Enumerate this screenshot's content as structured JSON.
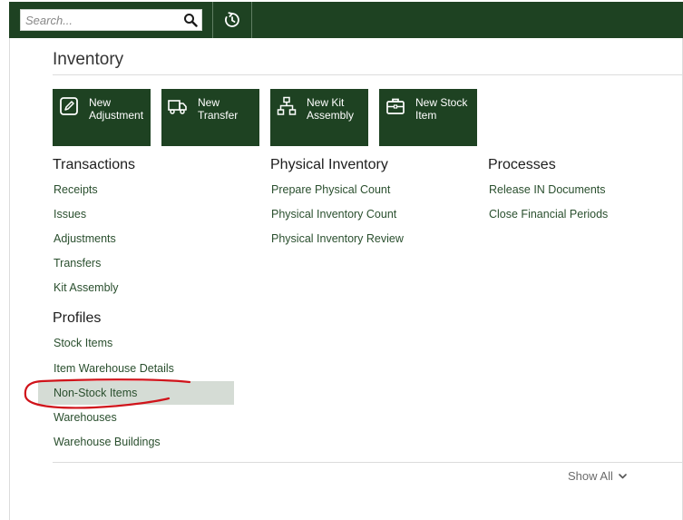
{
  "header": {
    "search_placeholder": "Search...",
    "search_icon": "search-icon",
    "history_icon": "history-icon"
  },
  "page": {
    "title": "Inventory"
  },
  "tiles": [
    {
      "line1": "New",
      "line2": "Adjustment",
      "icon": "edit-icon"
    },
    {
      "line1": "New",
      "line2": "Transfer",
      "icon": "truck-icon"
    },
    {
      "line1": "New Kit",
      "line2": "Assembly",
      "icon": "hierarchy-icon"
    },
    {
      "line1": "New Stock",
      "line2": "Item",
      "icon": "briefcase-icon"
    }
  ],
  "sections": {
    "transactions": {
      "title": "Transactions",
      "items": [
        "Receipts",
        "Issues",
        "Adjustments",
        "Transfers",
        "Kit Assembly"
      ]
    },
    "physical_inventory": {
      "title": "Physical Inventory",
      "items": [
        "Prepare Physical Count",
        "Physical Inventory Count",
        "Physical Inventory Review"
      ]
    },
    "processes": {
      "title": "Processes",
      "items": [
        "Release IN Documents",
        "Close Financial Periods"
      ]
    },
    "profiles": {
      "title": "Profiles",
      "items": [
        "Stock Items",
        "Item Warehouse Details",
        "Non-Stock Items",
        "Warehouses",
        "Warehouse Buildings"
      ],
      "highlighted": "Non-Stock Items"
    }
  },
  "footer": {
    "show_all": "Show All"
  },
  "colors": {
    "brand": "#1e4222",
    "link": "#2a4f2e",
    "highlight": "#d5dcd5",
    "annotation": "#d0141b"
  }
}
